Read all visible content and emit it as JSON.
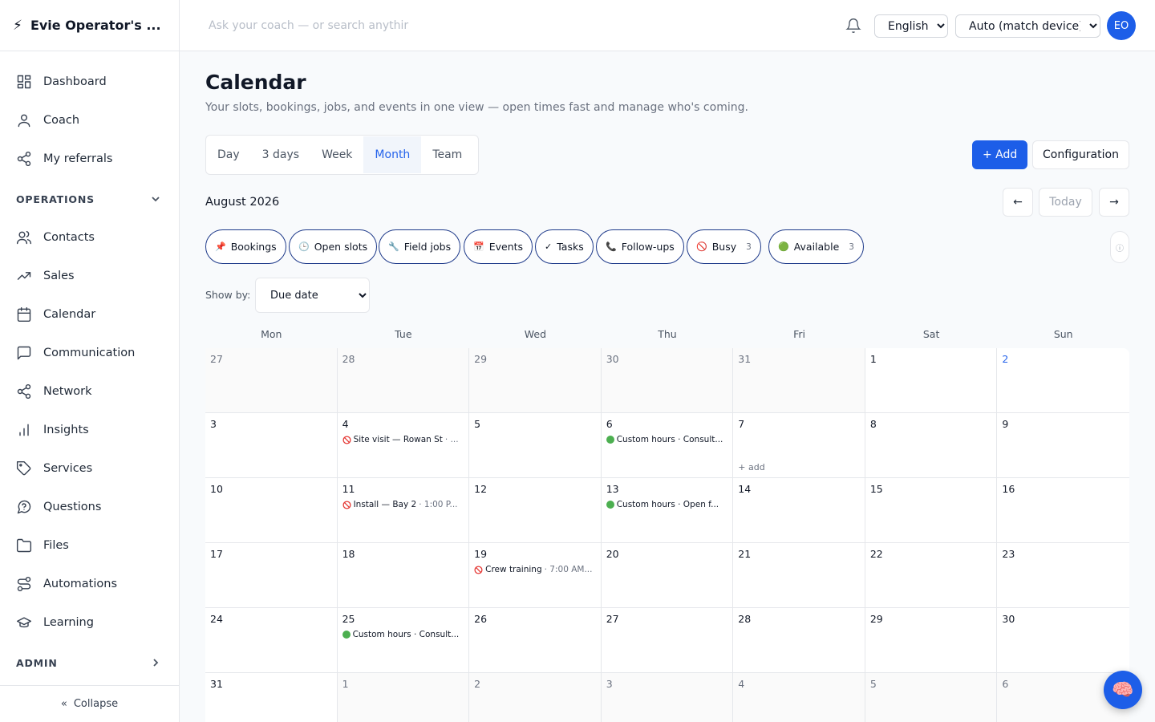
{
  "app": {
    "name": "Evie Operator's ...",
    "bolt": "⚡"
  },
  "sidebar": {
    "top_items": [
      {
        "label": "Dashboard",
        "icon": "dashboard-icon"
      },
      {
        "label": "Coach",
        "icon": "user-icon"
      },
      {
        "label": "My referrals",
        "icon": "share-icon"
      }
    ],
    "operations_header": "OPERATIONS",
    "operations_items": [
      {
        "label": "Contacts",
        "icon": "users-icon"
      },
      {
        "label": "Sales",
        "icon": "trending-up-icon"
      },
      {
        "label": "Calendar",
        "icon": "calendar-icon"
      },
      {
        "label": "Communication",
        "icon": "message-icon"
      },
      {
        "label": "Network",
        "icon": "share-icon"
      },
      {
        "label": "Insights",
        "icon": "bar-chart-icon"
      },
      {
        "label": "Services",
        "icon": "tag-icon"
      },
      {
        "label": "Questions",
        "icon": "help-circle-icon"
      },
      {
        "label": "Files",
        "icon": "folder-icon"
      },
      {
        "label": "Automations",
        "icon": "route-icon"
      },
      {
        "label": "Learning",
        "icon": "graduation-cap-icon"
      }
    ],
    "admin_header": "ADMIN",
    "collapse_label": "Collapse",
    "collapse_glyph": "«"
  },
  "topbar": {
    "search_placeholder": "Ask your coach — or search anythir",
    "language": "English",
    "language_options": [
      "English"
    ],
    "theme": "Auto (match device)",
    "theme_options": [
      "Auto (match device)"
    ],
    "avatar_initials": "EO"
  },
  "page": {
    "title": "Calendar",
    "subtitle": "Your slots, bookings, jobs, and events in one view — open times fast and manage who's coming.",
    "view_tabs": [
      "Day",
      "3 days",
      "Week",
      "Month",
      "Team"
    ],
    "active_view": "Month",
    "add_label": "+ Add",
    "config_label": "Configuration",
    "month_label": "August 2026",
    "prev_label": "←",
    "today_label": "Today",
    "next_label": "→",
    "info_glyph": "ⓘ",
    "show_by_label": "Show by:",
    "show_by_value": "Due date",
    "show_by_options": [
      "Due date"
    ],
    "fab_icon": "brain-icon",
    "fab_glyph": "🧠"
  },
  "filters": [
    {
      "label": "Bookings",
      "icon": "pin-icon",
      "glyph": "📌",
      "count": ""
    },
    {
      "label": "Open slots",
      "icon": "clock-icon",
      "glyph": "🕒",
      "count": ""
    },
    {
      "label": "Field jobs",
      "icon": "wrench-icon",
      "glyph": "🔧",
      "count": ""
    },
    {
      "label": "Events",
      "icon": "calendar-icon",
      "glyph": "📅",
      "count": ""
    },
    {
      "label": "Tasks",
      "icon": "check-icon",
      "glyph": "✓",
      "count": ""
    },
    {
      "label": "Follow-ups",
      "icon": "phone-icon",
      "glyph": "📞",
      "count": ""
    },
    {
      "label": "Busy",
      "icon": "busy-icon",
      "glyph": "🚫",
      "count": "3"
    },
    {
      "label": "Available",
      "icon": "green-dot-icon",
      "glyph": "🟢",
      "count": "3"
    }
  ],
  "calendar": {
    "weekdays": [
      "Mon",
      "Tue",
      "Wed",
      "Thu",
      "Fri",
      "Sat",
      "Sun"
    ],
    "add_text": "+ add",
    "weeks": [
      [
        {
          "d": "27",
          "out": true
        },
        {
          "d": "28",
          "out": true
        },
        {
          "d": "29",
          "out": true
        },
        {
          "d": "30",
          "out": true
        },
        {
          "d": "31",
          "out": true
        },
        {
          "d": "1"
        },
        {
          "d": "2",
          "today": true
        }
      ],
      [
        {
          "d": "3"
        },
        {
          "d": "4",
          "events": [
            {
              "kind": "busy",
              "text": "Site visit — Rowan St",
              "time": "· ..."
            }
          ]
        },
        {
          "d": "5"
        },
        {
          "d": "6",
          "events": [
            {
              "kind": "available",
              "text": "Custom hours · Consult...",
              "time": ""
            }
          ]
        },
        {
          "d": "7",
          "add": true
        },
        {
          "d": "8"
        },
        {
          "d": "9"
        }
      ],
      [
        {
          "d": "10"
        },
        {
          "d": "11",
          "events": [
            {
              "kind": "busy",
              "text": "Install — Bay 2",
              "time": "· 1:00 P..."
            }
          ]
        },
        {
          "d": "12"
        },
        {
          "d": "13",
          "events": [
            {
              "kind": "available",
              "text": "Custom hours · Open f...",
              "time": ""
            }
          ]
        },
        {
          "d": "14"
        },
        {
          "d": "15"
        },
        {
          "d": "16"
        }
      ],
      [
        {
          "d": "17"
        },
        {
          "d": "18"
        },
        {
          "d": "19",
          "events": [
            {
              "kind": "busy",
              "text": "Crew training",
              "time": "· 7:00 AM..."
            }
          ]
        },
        {
          "d": "20"
        },
        {
          "d": "21"
        },
        {
          "d": "22"
        },
        {
          "d": "23"
        }
      ],
      [
        {
          "d": "24"
        },
        {
          "d": "25",
          "events": [
            {
              "kind": "available",
              "text": "Custom hours · Consult...",
              "time": ""
            }
          ]
        },
        {
          "d": "26"
        },
        {
          "d": "27"
        },
        {
          "d": "28"
        },
        {
          "d": "29"
        },
        {
          "d": "30"
        }
      ],
      [
        {
          "d": "31"
        },
        {
          "d": "1",
          "out": true
        },
        {
          "d": "2",
          "out": true
        },
        {
          "d": "3",
          "out": true
        },
        {
          "d": "4",
          "out": true
        },
        {
          "d": "5",
          "out": true
        },
        {
          "d": "6",
          "out": true
        }
      ]
    ]
  },
  "colors": {
    "accent": "#1d5ee8",
    "available": "#4caf50",
    "busy": "#e53935",
    "chip_border": "#1e3a8a"
  }
}
